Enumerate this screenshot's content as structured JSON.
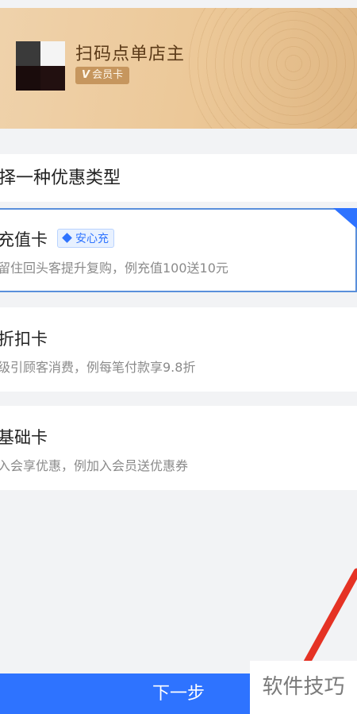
{
  "store": {
    "name": "扫码点单店主",
    "badge_label": "会员卡",
    "badge_mark": "V"
  },
  "section": {
    "title": "择一种优惠类型"
  },
  "options": [
    {
      "name": "充值卡",
      "tag": "安心充",
      "desc": "留住回头客提升复购，例充值100送10元",
      "selected": true
    },
    {
      "name": "折扣卡",
      "desc": "级引顾客消费，例每笔付款享9.8折",
      "selected": false
    },
    {
      "name": "基础卡",
      "desc": "入会享优惠，例加入会员送优惠券",
      "selected": false
    }
  ],
  "footer": {
    "next_label": "下一步"
  },
  "watermark": {
    "text": "软件技巧"
  },
  "colors": {
    "primary": "#2e73ff",
    "selected_border": "#5a8fdb",
    "card_gold": "#ecc898",
    "annotation_red": "#e53224"
  }
}
